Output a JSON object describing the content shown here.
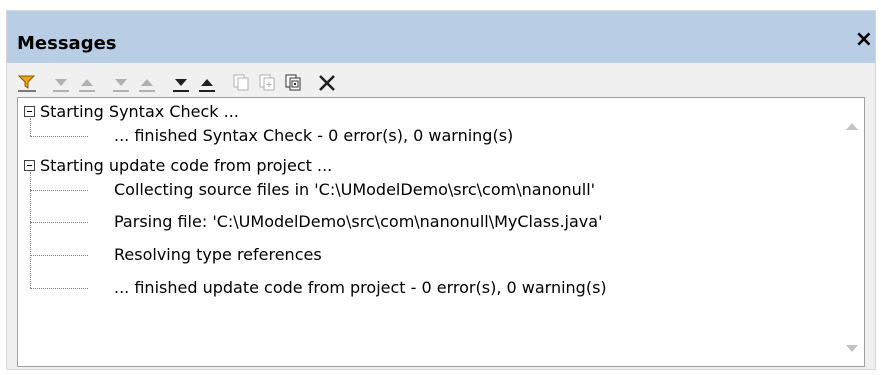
{
  "panel": {
    "title": "Messages",
    "close_glyph": "×"
  },
  "toolbar": {
    "buttons": [
      {
        "name": "filter",
        "icon": "filter-icon",
        "enabled": true
      },
      {
        "name": "next-error",
        "icon": "next-error-icon",
        "enabled": false
      },
      {
        "name": "previous-error",
        "icon": "previous-error-icon",
        "enabled": false
      },
      {
        "name": "next-warning",
        "icon": "next-warning-icon",
        "enabled": false
      },
      {
        "name": "previous-warning",
        "icon": "previous-warning-icon",
        "enabled": false
      },
      {
        "name": "next",
        "icon": "next-icon",
        "enabled": true
      },
      {
        "name": "previous",
        "icon": "previous-icon",
        "enabled": true
      },
      {
        "name": "copy",
        "icon": "copy-icon",
        "enabled": false
      },
      {
        "name": "copy-with-children",
        "icon": "copy-with-children-icon",
        "enabled": false
      },
      {
        "name": "copy-all",
        "icon": "copy-all-icon",
        "enabled": true
      },
      {
        "name": "clear",
        "icon": "clear-icon",
        "enabled": true
      }
    ]
  },
  "messages": {
    "groups": [
      {
        "header": "Starting Syntax Check ...",
        "children": [
          "... finished Syntax Check - 0 error(s), 0 warning(s)"
        ]
      },
      {
        "header": "Starting update code from project ...",
        "children": [
          "Collecting source files in 'C:\\UModelDemo\\src\\com\\nanonull'",
          "Parsing file: 'C:\\UModelDemo\\src\\com\\nanonull\\MyClass.java'",
          "Resolving type references",
          "... finished update code from project - 0 error(s), 0 warning(s)"
        ]
      }
    ]
  },
  "colors": {
    "titlebar": "#b9cde5",
    "filter_icon": "#e8a317",
    "disabled_icon": "#b0b0b0",
    "enabled_icon": "#202020"
  }
}
